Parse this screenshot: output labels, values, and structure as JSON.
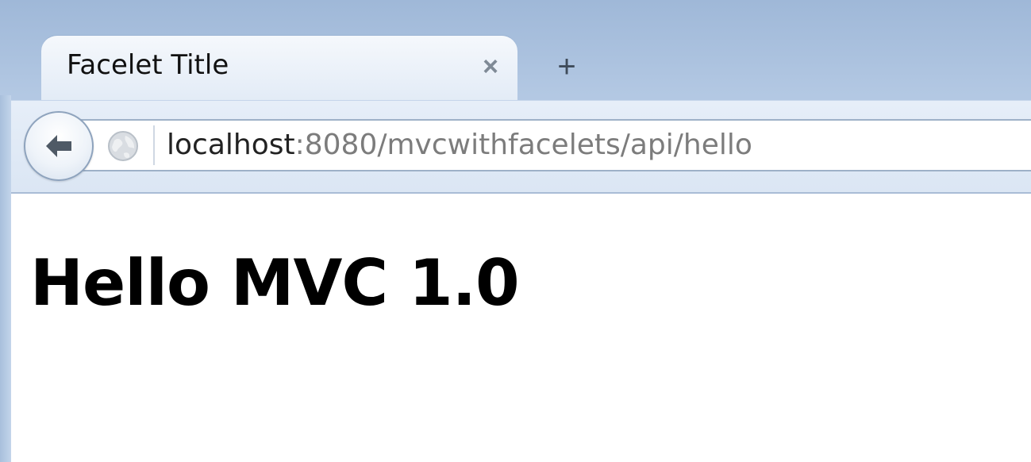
{
  "tab": {
    "title": "Facelet Title",
    "close_label": "×",
    "new_tab_label": "+"
  },
  "address_bar": {
    "host": "localhost",
    "rest": ":8080/mvcwithfacelets/api/hello"
  },
  "icons": {
    "back": "back-arrow-icon",
    "site_identity": "globe-icon"
  },
  "page": {
    "heading": "Hello MVC 1.0"
  }
}
